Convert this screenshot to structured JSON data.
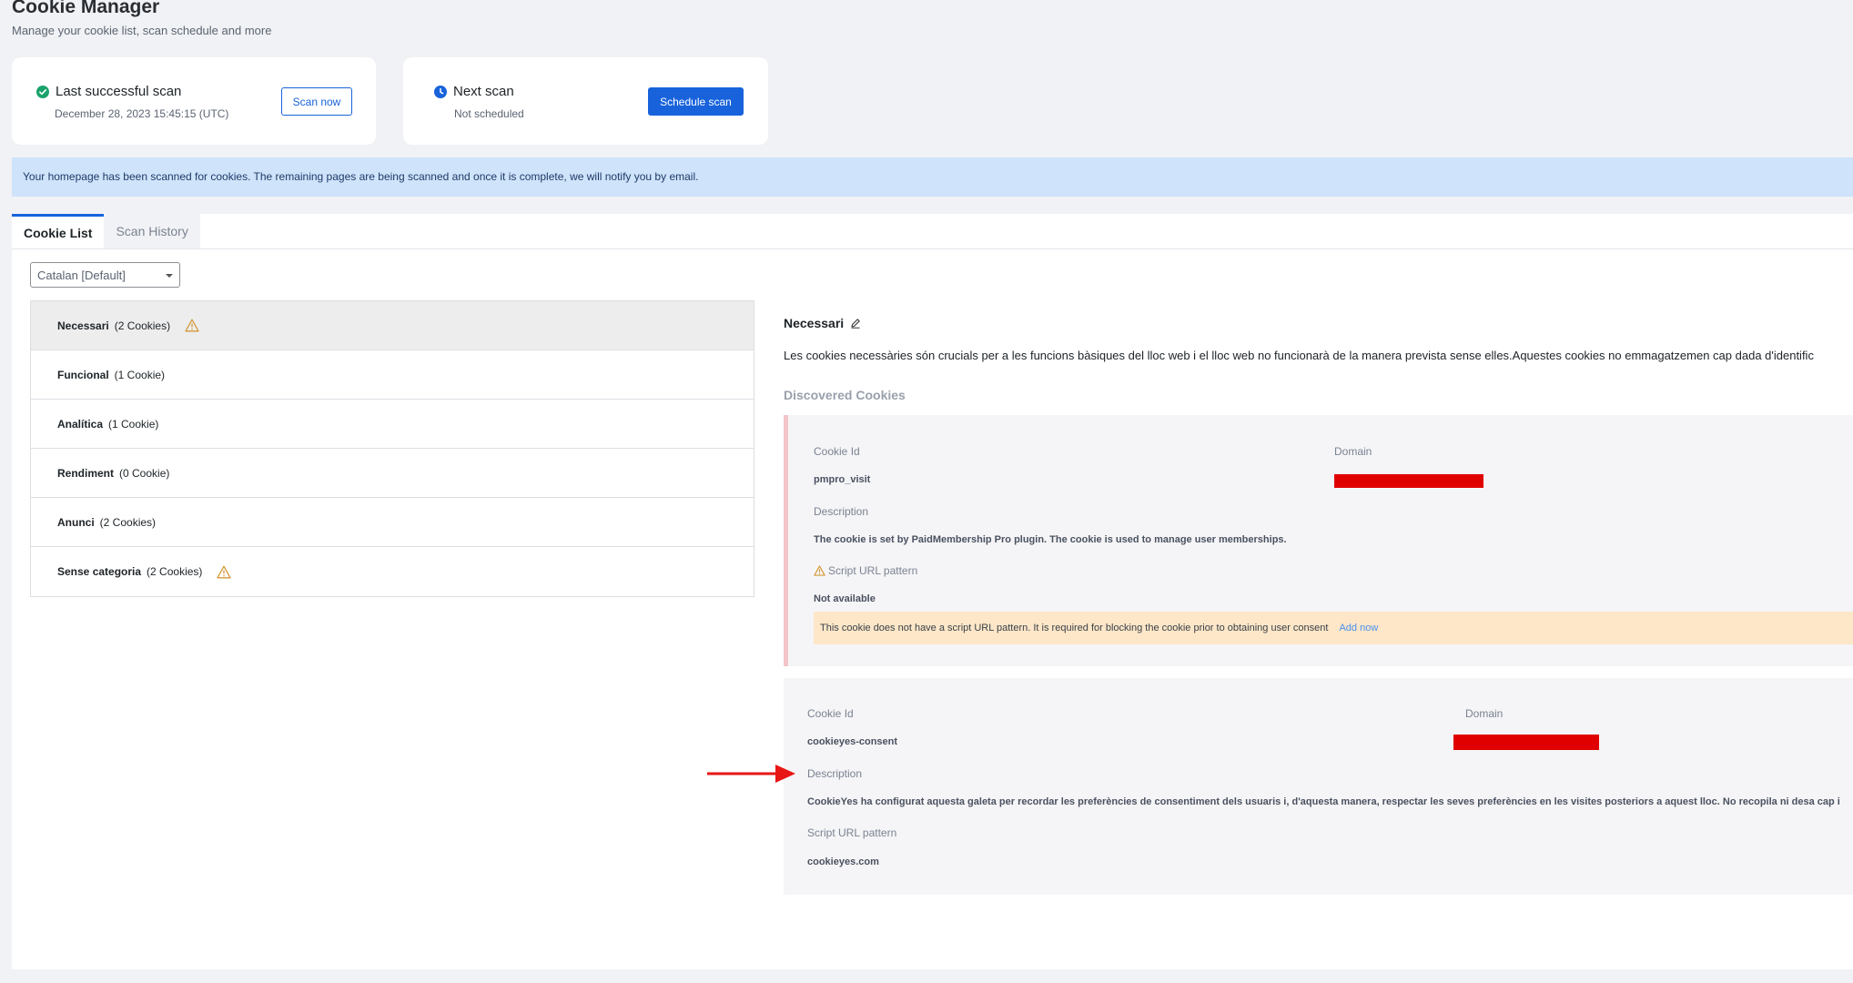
{
  "header": {
    "title": "Cookie Manager",
    "subtitle": "Manage your cookie list, scan schedule and more"
  },
  "last_scan": {
    "title": "Last successful scan",
    "date": "December 28, 2023 15:45:15 (UTC)",
    "button": "Scan now",
    "icon": "check-circle-icon",
    "icon_color": "#1aa36b"
  },
  "next_scan": {
    "title": "Next scan",
    "status": "Not scheduled",
    "button": "Schedule scan",
    "icon": "clock-icon",
    "icon_color": "#1863dc"
  },
  "notice": "Your homepage has been scanned for cookies. The remaining pages are being scanned and once it is complete, we will notify you by email.",
  "tabs": [
    {
      "label": "Cookie List",
      "active": true
    },
    {
      "label": "Scan History",
      "active": false
    }
  ],
  "language_select": {
    "value": "Catalan [Default]"
  },
  "categories": [
    {
      "name": "Necessari",
      "count": "(2 Cookies)",
      "warning": true,
      "selected": true
    },
    {
      "name": "Funcional",
      "count": "(1 Cookie)",
      "warning": false,
      "selected": false
    },
    {
      "name": "Analítica",
      "count": "(1 Cookie)",
      "warning": false,
      "selected": false
    },
    {
      "name": "Rendiment",
      "count": "(0 Cookie)",
      "warning": false,
      "selected": false
    },
    {
      "name": "Anunci",
      "count": "(2 Cookies)",
      "warning": false,
      "selected": false
    },
    {
      "name": "Sense categoria",
      "count": "(2 Cookies)",
      "warning": true,
      "selected": false
    }
  ],
  "detail": {
    "title": "Necessari",
    "description": "Les cookies necessàries són crucials per a les funcions bàsiques del lloc web i el lloc web no funcionarà de la manera prevista sense elles.Aquestes cookies no emmagatzemen cap dada d'identific",
    "discovered_label": "Discovered Cookies"
  },
  "labels": {
    "cookie_id": "Cookie Id",
    "domain": "Domain",
    "description": "Description",
    "script_url_pattern": "Script URL pattern"
  },
  "cookies": [
    {
      "id": "pmpro_visit",
      "description": "The cookie is set by PaidMembership Pro plugin. The cookie is used to manage user memberships.",
      "script_url": "Not available",
      "warning_text": "This cookie does not have a script URL pattern. It is required for blocking the cookie prior to obtaining user consent",
      "warning_link": "Add now"
    },
    {
      "id": "cookieyes-consent",
      "description": "CookieYes ha configurat aquesta galeta per recordar les preferències de consentiment dels usuaris i, d'aquesta manera, respectar les seves preferències en les visites posteriors a aquest lloc. No recopila ni desa cap i",
      "script_url": "cookieyes.com"
    }
  ],
  "colors": {
    "accent": "#1863dc",
    "notice_bg": "#cfe3fb",
    "warning_bg": "#fde7c8",
    "warning_icon": "#d49a3a",
    "redaction": "#e00000",
    "annotation_arrow": "#e81515"
  }
}
